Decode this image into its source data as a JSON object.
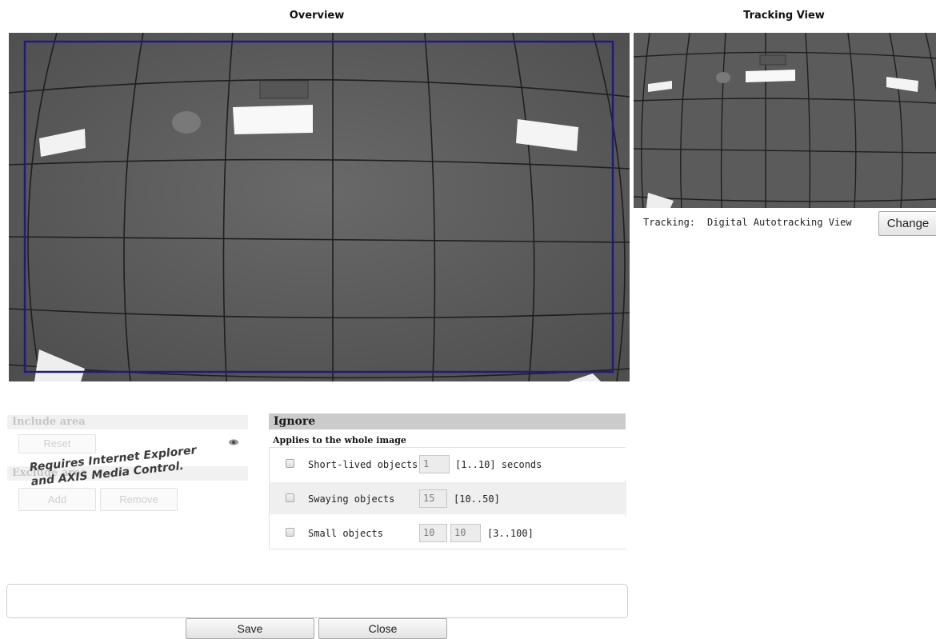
{
  "overview": {
    "title": "Overview"
  },
  "tracking_view": {
    "title": "Tracking View",
    "tracking_label": "Tracking:",
    "tracking_value": "Digital Autotracking View",
    "change_label": "Change"
  },
  "include_area": {
    "header": "Include area",
    "reset_label": "Reset"
  },
  "exclude_area": {
    "header": "Exclude area",
    "add_label": "Add",
    "remove_label": "Remove"
  },
  "notice": {
    "line1": "Requires Internet Explorer",
    "line2": "and AXIS Media Control."
  },
  "ignore": {
    "header": "Ignore",
    "subheader": "Applies to the whole image",
    "rows": [
      {
        "label": "Short-lived objects",
        "value1": "1",
        "range": "[1..10] seconds"
      },
      {
        "label": "Swaying objects",
        "value1": "15",
        "range": "[10..50]"
      },
      {
        "label": "Small objects",
        "value1": "10",
        "value2": "10",
        "range": "[3..100]"
      }
    ]
  },
  "footer": {
    "save_label": "Save",
    "close_label": "Close"
  },
  "colors": {
    "overview_frame": "#1c1c7a",
    "camera_bg": "#5f5e5f",
    "ignore_header_bg": "#cbcbcb",
    "stripe_row_bg": "#efefef"
  }
}
